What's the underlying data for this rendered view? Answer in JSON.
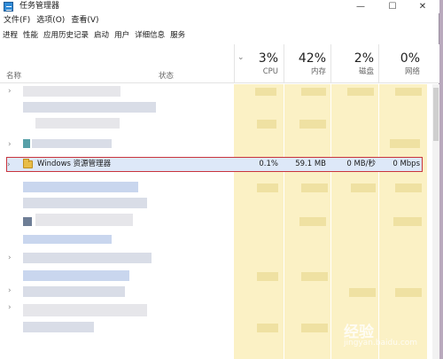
{
  "window": {
    "title": "任务管理器"
  },
  "menu": [
    "文件(F)",
    "选项(O)",
    "查看(V)"
  ],
  "tabs": [
    "进程",
    "性能",
    "应用历史记录",
    "启动",
    "用户",
    "详细信息",
    "服务"
  ],
  "columns": {
    "name": "名称",
    "status": "状态",
    "cpu": {
      "pct": "3%",
      "label": "CPU"
    },
    "memory": {
      "pct": "42%",
      "label": "内存"
    },
    "disk": {
      "pct": "2%",
      "label": "磁盘"
    },
    "network": {
      "pct": "0%",
      "label": "网络"
    }
  },
  "highlighted_row": {
    "name": "Windows 资源管理器",
    "cpu": "0.1%",
    "memory": "59.1 MB",
    "disk": "0 MB/秒",
    "network": "0 Mbps"
  },
  "colors": {
    "highlight_border": "#c9343d",
    "column_highlight": "#fbf1c5"
  },
  "watermark": {
    "text": "经验",
    "url": "jingyan.baidu.com"
  }
}
